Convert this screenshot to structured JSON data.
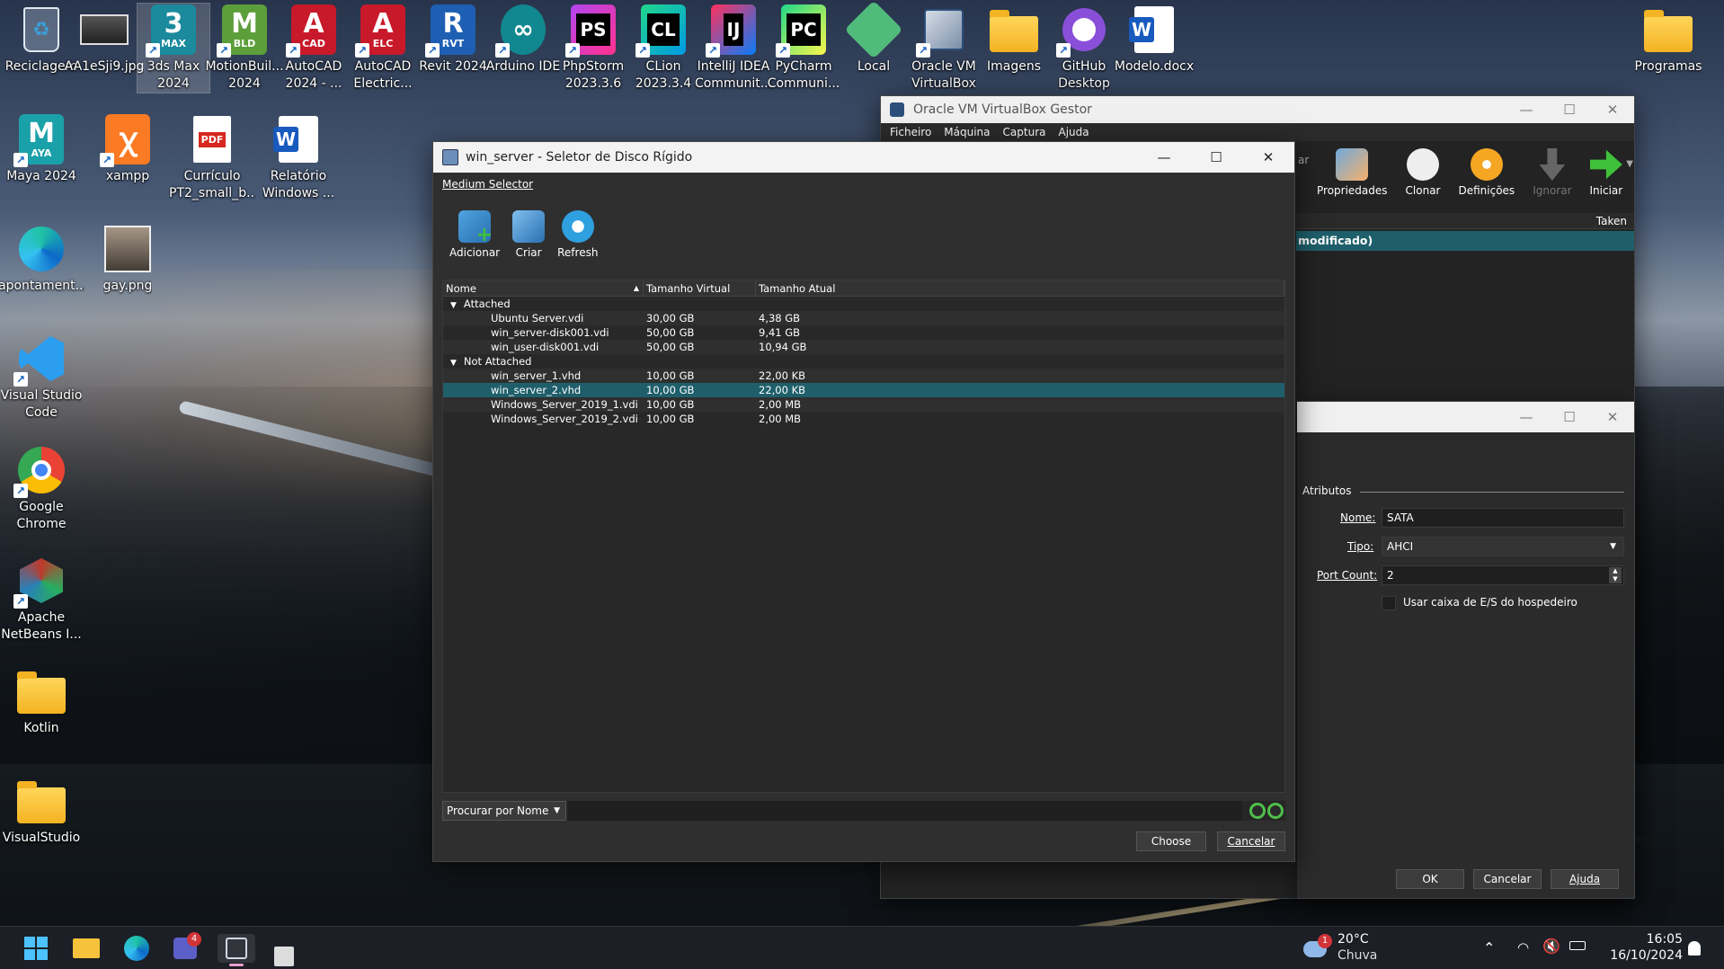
{
  "desktop": {
    "icons": [
      {
        "label": "Reciclagem"
      },
      {
        "label": "AA1eSji9.jpg"
      },
      {
        "label": "3ds Max 2024",
        "badge": "3",
        "sub": "MAX"
      },
      {
        "label": "MotionBuil...\n2024",
        "badge": "M",
        "sub": "BLD"
      },
      {
        "label": "AutoCAD\n2024 - ...",
        "badge": "A",
        "sub": "CAD"
      },
      {
        "label": "AutoCAD\nElectric...",
        "badge": "A",
        "sub": "ELC"
      },
      {
        "label": "Revit 2024",
        "badge": "R",
        "sub": "RVT"
      },
      {
        "label": "Arduino IDE",
        "badge": "∞"
      },
      {
        "label": "PhpStorm\n2023.3.6",
        "badge": "PS"
      },
      {
        "label": "CLion\n2023.3.4",
        "badge": "CL"
      },
      {
        "label": "IntelliJ IDEA\nCommunit...",
        "badge": "IJ"
      },
      {
        "label": "PyCharm\nCommuni...",
        "badge": "PC"
      },
      {
        "label": "Local"
      },
      {
        "label": "Oracle VM\nVirtualBox"
      },
      {
        "label": "Imagens"
      },
      {
        "label": "GitHub\nDesktop"
      },
      {
        "label": "Modelo.docx",
        "badge": "W"
      },
      {
        "label": "Programas"
      },
      {
        "label": "Maya 2024",
        "badge": "M",
        "sub": "AYA"
      },
      {
        "label": "xampp"
      },
      {
        "label": "Currículo\nPT2_small_b...",
        "badge": "PDF"
      },
      {
        "label": "Relatório\nWindows ...",
        "badge": "W"
      },
      {
        "label": "apontament..."
      },
      {
        "label": "gay.png"
      },
      {
        "label": "Visual Studio\nCode"
      },
      {
        "label": "Google\nChrome"
      },
      {
        "label": "Apache\nNetBeans I..."
      },
      {
        "label": "Kotlin"
      },
      {
        "label": "VisualStudio"
      }
    ]
  },
  "vbox_manager": {
    "title": "Oracle VM VirtualBox Gestor",
    "menu": [
      "Ficheiro",
      "Máquina",
      "Captura",
      "Ajuda"
    ],
    "toolbar": [
      "Propriedades",
      "Clonar",
      "Definições",
      "Ignorar",
      "Iniciar"
    ],
    "partial_label": "ar",
    "column_taken": "Taken",
    "selected_row": "modificado)"
  },
  "settings_dialog": {
    "section": "Atributos",
    "nome_label": "Nome:",
    "nome_value": "SATA",
    "tipo_label": "Tipo:",
    "tipo_value": "AHCI",
    "port_label": "Port Count:",
    "port_value": "2",
    "checkbox_label": "Usar caixa de E/S do hospedeiro",
    "ok": "OK",
    "cancel": "Cancelar",
    "help": "Ajuda"
  },
  "selector": {
    "title": "win_server - Seletor de Disco Rígido",
    "menu": "Medium Selector",
    "toolbar": [
      "Adicionar",
      "Criar",
      "Refresh"
    ],
    "columns": [
      "Nome",
      "Tamanho Virtual",
      "Tamanho Atual"
    ],
    "groups": [
      {
        "name": "Attached",
        "rows": [
          {
            "name": "Ubuntu Server.vdi",
            "virtual": "30,00 GB",
            "actual": "4,38 GB"
          },
          {
            "name": "win_server-disk001.vdi",
            "virtual": "50,00 GB",
            "actual": "9,41 GB"
          },
          {
            "name": "win_user-disk001.vdi",
            "virtual": "50,00 GB",
            "actual": "10,94 GB"
          }
        ]
      },
      {
        "name": "Not Attached",
        "rows": [
          {
            "name": "win_server_1.vhd",
            "virtual": "10,00 GB",
            "actual": "22,00 KB"
          },
          {
            "name": "win_server_2.vhd",
            "virtual": "10,00 GB",
            "actual": "22,00 KB",
            "selected": true
          },
          {
            "name": "Windows_Server_2019_1.vdi",
            "virtual": "10,00 GB",
            "actual": "2,00 MB"
          },
          {
            "name": "Windows_Server_2019_2.vdi",
            "virtual": "10,00 GB",
            "actual": "2,00 MB"
          }
        ]
      }
    ],
    "search_mode": "Procurar por Nome",
    "choose": "Choose",
    "cancel": "Cancelar"
  },
  "taskbar": {
    "teams_badge": "4",
    "weather_badge": "1",
    "temperature": "20°C",
    "weather": "Chuva",
    "time": "16:05",
    "date": "16/10/2024"
  }
}
